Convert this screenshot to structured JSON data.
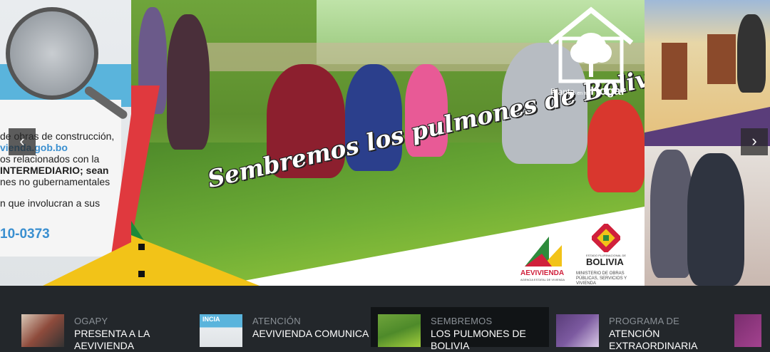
{
  "carousel": {
    "prev_glyph": "‹",
    "next_glyph": "›",
    "left_slide": {
      "lines": [
        "de obras de construcción,",
        "vienda.gob.bo",
        "os relacionados con la",
        "INTERMEDIARIO; sean",
        "nes no gubernamentales",
        "n que involucran a sus"
      ],
      "phone": "10-0373"
    },
    "center_slide": {
      "slogan": "Sembremos los pulmones de Bolivia",
      "logo_text_left": "Planta",
      "logo_text_small": "en tu",
      "logo_text_right": "Hogar",
      "aevivienda_name": "AEVIVIENDA",
      "aevivienda_sub": "AGENCIA ESTATAL DE VIVIENDA",
      "bolivia_small": "ESTADO PLURINACIONAL DE",
      "bolivia_name": "BOLIVIA",
      "ministry": "MINISTERIO DE OBRAS PÚBLICAS, SERVICIOS Y VIVIENDA"
    }
  },
  "thumbnails": [
    {
      "category": "OGAPY",
      "title": "PRESENTA A LA AEVIVIENDA"
    },
    {
      "category": "ATENCIÓN",
      "title": "AEVIVIENDA COMUNICA"
    },
    {
      "category": "SEMBREMOS",
      "title": "LOS PULMONES DE BOLIVIA"
    },
    {
      "category": "PROGRAMA DE",
      "title": "ATENCIÓN EXTRAORDINARIA"
    }
  ],
  "thumb_banner_text": "INCIA",
  "colors": {
    "page_bg": "#23272b",
    "accent_red": "#e0393e",
    "accent_yellow": "#f2c318",
    "accent_green": "#1d8a3a",
    "link_blue": "#3a8fd0"
  }
}
